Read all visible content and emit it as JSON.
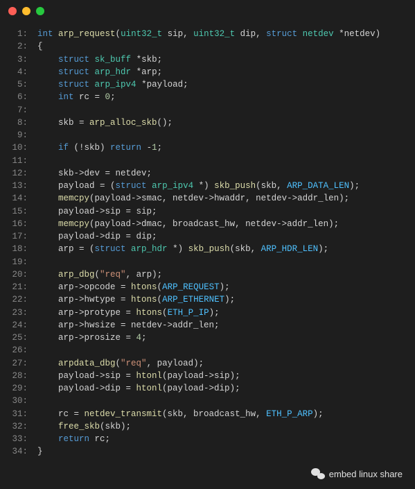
{
  "window": {
    "traffic_lights": [
      "close",
      "minimize",
      "zoom"
    ]
  },
  "code": {
    "language": "c",
    "lines": [
      {
        "n": "1:",
        "tokens": [
          [
            "kw",
            "int"
          ],
          [
            "plain",
            " "
          ],
          [
            "fn",
            "arp_request"
          ],
          [
            "plain",
            "("
          ],
          [
            "type",
            "uint32_t"
          ],
          [
            "plain",
            " sip, "
          ],
          [
            "type",
            "uint32_t"
          ],
          [
            "plain",
            " dip, "
          ],
          [
            "kw",
            "struct"
          ],
          [
            "plain",
            " "
          ],
          [
            "type",
            "netdev"
          ],
          [
            "plain",
            " *netdev)"
          ]
        ]
      },
      {
        "n": "2:",
        "tokens": [
          [
            "plain",
            "{"
          ]
        ]
      },
      {
        "n": "3:",
        "tokens": [
          [
            "plain",
            "    "
          ],
          [
            "kw",
            "struct"
          ],
          [
            "plain",
            " "
          ],
          [
            "type",
            "sk_buff"
          ],
          [
            "plain",
            " *skb;"
          ]
        ]
      },
      {
        "n": "4:",
        "tokens": [
          [
            "plain",
            "    "
          ],
          [
            "kw",
            "struct"
          ],
          [
            "plain",
            " "
          ],
          [
            "type",
            "arp_hdr"
          ],
          [
            "plain",
            " *arp;"
          ]
        ]
      },
      {
        "n": "5:",
        "tokens": [
          [
            "plain",
            "    "
          ],
          [
            "kw",
            "struct"
          ],
          [
            "plain",
            " "
          ],
          [
            "type",
            "arp_ipv4"
          ],
          [
            "plain",
            " *payload;"
          ]
        ]
      },
      {
        "n": "6:",
        "tokens": [
          [
            "plain",
            "    "
          ],
          [
            "kw",
            "int"
          ],
          [
            "plain",
            " rc = "
          ],
          [
            "num",
            "0"
          ],
          [
            "plain",
            ";"
          ]
        ]
      },
      {
        "n": "7:",
        "tokens": [
          [
            "plain",
            ""
          ]
        ]
      },
      {
        "n": "8:",
        "tokens": [
          [
            "plain",
            "    skb = "
          ],
          [
            "fn",
            "arp_alloc_skb"
          ],
          [
            "plain",
            "();"
          ]
        ]
      },
      {
        "n": "9:",
        "tokens": [
          [
            "plain",
            ""
          ]
        ]
      },
      {
        "n": "10:",
        "tokens": [
          [
            "plain",
            "    "
          ],
          [
            "kw",
            "if"
          ],
          [
            "plain",
            " (!skb) "
          ],
          [
            "kw",
            "return"
          ],
          [
            "plain",
            " -"
          ],
          [
            "num",
            "1"
          ],
          [
            "plain",
            ";"
          ]
        ]
      },
      {
        "n": "11:",
        "tokens": [
          [
            "plain",
            ""
          ]
        ]
      },
      {
        "n": "12:",
        "tokens": [
          [
            "plain",
            "    skb->dev = netdev;"
          ]
        ]
      },
      {
        "n": "13:",
        "tokens": [
          [
            "plain",
            "    payload = ("
          ],
          [
            "kw",
            "struct"
          ],
          [
            "plain",
            " "
          ],
          [
            "type",
            "arp_ipv4"
          ],
          [
            "plain",
            " *) "
          ],
          [
            "fn",
            "skb_push"
          ],
          [
            "plain",
            "(skb, "
          ],
          [
            "const",
            "ARP_DATA_LEN"
          ],
          [
            "plain",
            ");"
          ]
        ]
      },
      {
        "n": "14:",
        "tokens": [
          [
            "plain",
            "    "
          ],
          [
            "fn",
            "memcpy"
          ],
          [
            "plain",
            "(payload->smac, netdev->hwaddr, netdev->addr_len);"
          ]
        ]
      },
      {
        "n": "15:",
        "tokens": [
          [
            "plain",
            "    payload->sip = sip;"
          ]
        ]
      },
      {
        "n": "16:",
        "tokens": [
          [
            "plain",
            "    "
          ],
          [
            "fn",
            "memcpy"
          ],
          [
            "plain",
            "(payload->dmac, broadcast_hw, netdev->addr_len);"
          ]
        ]
      },
      {
        "n": "17:",
        "tokens": [
          [
            "plain",
            "    payload->dip = dip;"
          ]
        ]
      },
      {
        "n": "18:",
        "tokens": [
          [
            "plain",
            "    arp = ("
          ],
          [
            "kw",
            "struct"
          ],
          [
            "plain",
            " "
          ],
          [
            "type",
            "arp_hdr"
          ],
          [
            "plain",
            " *) "
          ],
          [
            "fn",
            "skb_push"
          ],
          [
            "plain",
            "(skb, "
          ],
          [
            "const",
            "ARP_HDR_LEN"
          ],
          [
            "plain",
            ");"
          ]
        ]
      },
      {
        "n": "19:",
        "tokens": [
          [
            "plain",
            ""
          ]
        ]
      },
      {
        "n": "20:",
        "tokens": [
          [
            "plain",
            "    "
          ],
          [
            "fn",
            "arp_dbg"
          ],
          [
            "plain",
            "("
          ],
          [
            "str",
            "\"req\""
          ],
          [
            "plain",
            ", arp);"
          ]
        ]
      },
      {
        "n": "21:",
        "tokens": [
          [
            "plain",
            "    arp->opcode = "
          ],
          [
            "fn",
            "htons"
          ],
          [
            "plain",
            "("
          ],
          [
            "const",
            "ARP_REQUEST"
          ],
          [
            "plain",
            ");"
          ]
        ]
      },
      {
        "n": "22:",
        "tokens": [
          [
            "plain",
            "    arp->hwtype = "
          ],
          [
            "fn",
            "htons"
          ],
          [
            "plain",
            "("
          ],
          [
            "const",
            "ARP_ETHERNET"
          ],
          [
            "plain",
            ");"
          ]
        ]
      },
      {
        "n": "23:",
        "tokens": [
          [
            "plain",
            "    arp->protype = "
          ],
          [
            "fn",
            "htons"
          ],
          [
            "plain",
            "("
          ],
          [
            "const",
            "ETH_P_IP"
          ],
          [
            "plain",
            ");"
          ]
        ]
      },
      {
        "n": "24:",
        "tokens": [
          [
            "plain",
            "    arp->hwsize = netdev->addr_len;"
          ]
        ]
      },
      {
        "n": "25:",
        "tokens": [
          [
            "plain",
            "    arp->prosize = "
          ],
          [
            "num",
            "4"
          ],
          [
            "plain",
            ";"
          ]
        ]
      },
      {
        "n": "26:",
        "tokens": [
          [
            "plain",
            ""
          ]
        ]
      },
      {
        "n": "27:",
        "tokens": [
          [
            "plain",
            "    "
          ],
          [
            "fn",
            "arpdata_dbg"
          ],
          [
            "plain",
            "("
          ],
          [
            "str",
            "\"req\""
          ],
          [
            "plain",
            ", payload);"
          ]
        ]
      },
      {
        "n": "28:",
        "tokens": [
          [
            "plain",
            "    payload->sip = "
          ],
          [
            "fn",
            "htonl"
          ],
          [
            "plain",
            "(payload->sip);"
          ]
        ]
      },
      {
        "n": "29:",
        "tokens": [
          [
            "plain",
            "    payload->dip = "
          ],
          [
            "fn",
            "htonl"
          ],
          [
            "plain",
            "(payload->dip);"
          ]
        ]
      },
      {
        "n": "30:",
        "tokens": [
          [
            "plain",
            ""
          ]
        ]
      },
      {
        "n": "31:",
        "tokens": [
          [
            "plain",
            "    rc = "
          ],
          [
            "fn",
            "netdev_transmit"
          ],
          [
            "plain",
            "(skb, broadcast_hw, "
          ],
          [
            "const",
            "ETH_P_ARP"
          ],
          [
            "plain",
            ");"
          ]
        ]
      },
      {
        "n": "32:",
        "tokens": [
          [
            "plain",
            "    "
          ],
          [
            "fn",
            "free_skb"
          ],
          [
            "plain",
            "(skb);"
          ]
        ]
      },
      {
        "n": "33:",
        "tokens": [
          [
            "plain",
            "    "
          ],
          [
            "kw",
            "return"
          ],
          [
            "plain",
            " rc;"
          ]
        ]
      },
      {
        "n": "34:",
        "tokens": [
          [
            "plain",
            "}"
          ]
        ]
      }
    ]
  },
  "watermark": {
    "text": "embed linux share",
    "icon": "wechat-icon"
  }
}
